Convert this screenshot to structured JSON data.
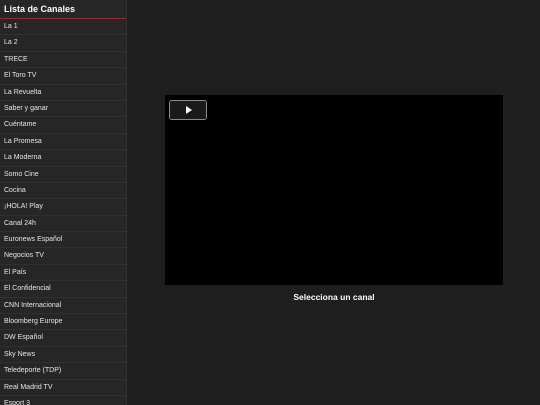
{
  "sidebar": {
    "title": "Lista de Canales",
    "channels": [
      "La 1",
      "La 2",
      "TRECE",
      "El Toro TV",
      "La Revuelta",
      "Saber y ganar",
      "Cuéntame",
      "La Promesa",
      "La Moderna",
      "Somo Cine",
      "Cocina",
      "¡HOLA! Play",
      "Canal 24h",
      "Euronews Español",
      "Negocios TV",
      "El País",
      "El Confidencial",
      "CNN Internacional",
      "Bloomberg Europe",
      "DW Español",
      "Sky News",
      "Teledeporte (TDP)",
      "Real Madrid TV",
      "Esport 3"
    ]
  },
  "player": {
    "play_icon": "play-icon"
  },
  "status": {
    "text": "Selecciona un canal"
  },
  "colors": {
    "accent": "#e50914",
    "sidebar_bg": "#262626",
    "main_bg": "#1e1e1e",
    "player_bg": "#000000"
  }
}
